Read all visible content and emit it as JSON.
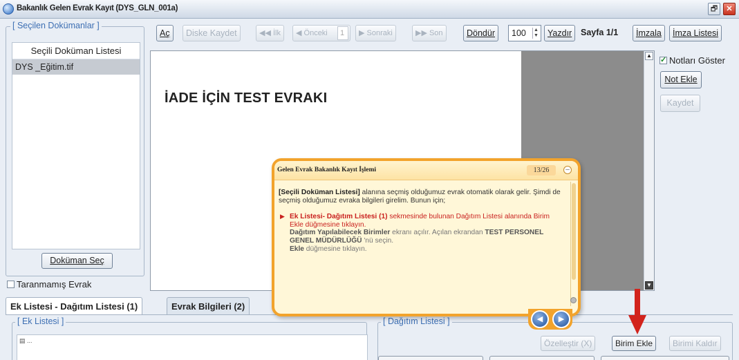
{
  "window": {
    "title": "Bakanlık Gelen Evrak Kayıt (DYS_GLN_001a)",
    "restore_label": "🗗",
    "close_label": "✕"
  },
  "left_panel": {
    "legend": "[ Seçilen Dokümanlar ]",
    "list_header": "Seçili Doküman Listesi",
    "items": [
      "DYS _Eğitim.tif"
    ],
    "select_button": "Doküman Seç",
    "unscanned_label": "Taranmamış Evrak"
  },
  "toolbar": {
    "open": "Aç",
    "save_disk": "Diske Kaydet",
    "first": "◀◀ İlk",
    "prev": "◀ Önceki",
    "page_input": "1",
    "next": "▶ Sonraki",
    "last": "▶▶ Son",
    "rotate": "Döndür",
    "zoom": "100",
    "print": "Yazdır",
    "page_info": "Sayfa 1/1",
    "sign": "İmzala",
    "sign_list": "İmza Listesi"
  },
  "viewer": {
    "document_text": "İADE İÇİN TEST EVRAKI"
  },
  "right_panel": {
    "show_notes": "Notları Göster",
    "show_notes_checked": true,
    "add_note": "Not Ekle",
    "save": "Kaydet"
  },
  "tabs": [
    {
      "label": "Ek Listesi - Dağıtım Listesi (1)",
      "active": true
    },
    {
      "label": "Evrak Bilgileri (2)",
      "active": false
    }
  ],
  "ek_listesi": {
    "legend": "[ Ek Listesi ]",
    "file_label": "..."
  },
  "dagitim_listesi": {
    "legend": "[ Dağıtım Listesi ]",
    "buttons": {
      "special": "Özelleştir (X)",
      "add_unit": "Birim Ekle",
      "remove_unit": "Birimi Kaldır"
    }
  },
  "bubble": {
    "title": "Gelen Evrak Bakanlık Kayıt İşlemi",
    "counter": "13/26",
    "minimize": "–",
    "p1_bold": "[Seçili Doküman Listesi]",
    "p1_rest": " alanına seçmiş olduğumuz evrak otomatik olarak gelir. Şimdi de seçmiş olduğumuz evraka bilgileri girelim. Bunun için;",
    "p2_bold": "Ek Listesi- Dağıtım Listesi (1)",
    "p2_rest": " sekmesinde bulunan Dağıtım Listesi alanında Birim Ekle düğmesine tıklayın.",
    "p3_bold1": "Dağıtım Yapılabilecek Birimler",
    "p3_mid1": " ekranı açılır. Açılan ekrandan ",
    "p3_bold2": "TEST PERSONEL GENEL MÜDÜRLÜĞÜ",
    "p3_mid2": " 'nü seçin.",
    "p3_bold3": "Ekle",
    "p3_end": " düğmesine tıklayın.",
    "prev_label": "◀",
    "next_label": "▶"
  },
  "colors": {
    "bubble_border": "#f2a32c",
    "accent_red": "#c9211f",
    "legend_blue": "#3d6fb3"
  }
}
